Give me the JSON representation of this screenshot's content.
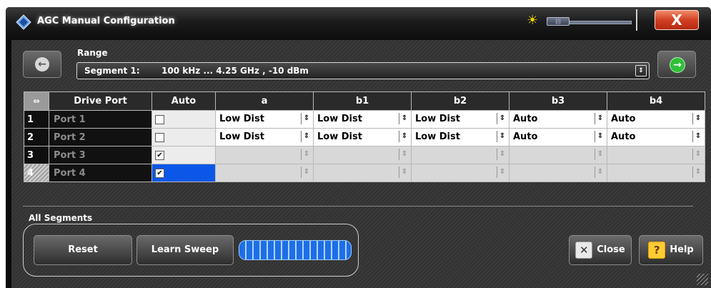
{
  "window": {
    "title": "AGC Manual Configuration",
    "close_label": "X"
  },
  "range": {
    "label": "Range",
    "segment": "Segment 1:",
    "value": "100 kHz ... 4.25 GHz ,   -10 dBm"
  },
  "table": {
    "headers": [
      "Drive Port",
      "Auto",
      "a",
      "b1",
      "b2",
      "b3",
      "b4"
    ],
    "rows": [
      {
        "num": "1",
        "port": "Port 1",
        "auto": false,
        "a": "Low Dist",
        "b1": "Low Dist",
        "b2": "Low Dist",
        "b3": "Auto",
        "b4": "Auto"
      },
      {
        "num": "2",
        "port": "Port 2",
        "auto": false,
        "a": "Low Dist",
        "b1": "Low Dist",
        "b2": "Low Dist",
        "b3": "Auto",
        "b4": "Auto"
      },
      {
        "num": "3",
        "port": "Port 3",
        "auto": true,
        "a": "",
        "b1": "",
        "b2": "",
        "b3": "",
        "b4": ""
      },
      {
        "num": "4",
        "port": "Port 4",
        "auto": true,
        "a": "",
        "b1": "",
        "b2": "",
        "b3": "",
        "b4": ""
      }
    ]
  },
  "all_segments": {
    "label": "All Segments",
    "reset_label": "Reset",
    "learn_label": "Learn Sweep",
    "progress": 1.0
  },
  "buttons": {
    "close_label": "Close",
    "help_label": "Help"
  },
  "colors": {
    "accent": "#0b58e8",
    "next": "#2fbf3a",
    "close": "#d14022"
  }
}
